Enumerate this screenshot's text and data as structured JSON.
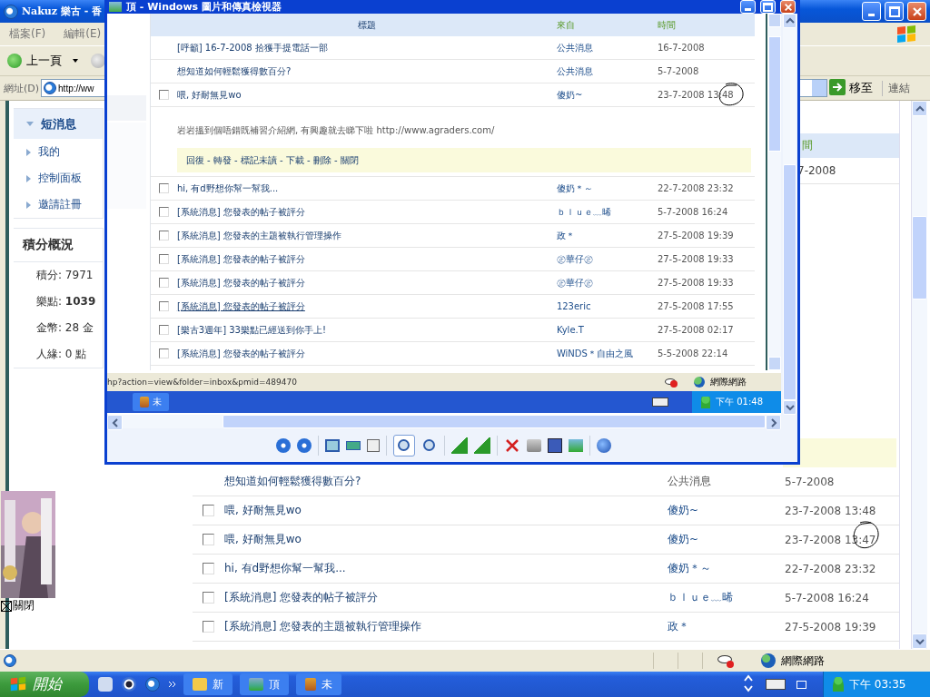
{
  "browser": {
    "title": "Nakuz 樂古 - 香",
    "menu": [
      "檔案(F)",
      "編輯(E)"
    ],
    "back_label": "上一頁",
    "address_label": "網址(D)",
    "address": "http://ww",
    "go_label": "移至",
    "links_label": "連結"
  },
  "sidebar": [
    {
      "label": "短消息",
      "selected": true
    },
    {
      "label": "我的",
      "selected": false
    },
    {
      "label": "控制面板",
      "selected": false
    },
    {
      "label": "邀請註冊",
      "selected": false
    }
  ],
  "points": {
    "title": "積分概況",
    "lines": [
      "積分: 7971",
      "樂點: **1039**",
      "金幣: 28 金",
      "人緣: 0 點"
    ]
  },
  "ad": {
    "kind": "picture",
    "close_label": "關閉"
  },
  "inbox": {
    "header_fragment": "間",
    "top_row_fragment": "7-2008",
    "rows": [
      {
        "kind": "notice",
        "subject": "想知道如何輕鬆獲得數百分?",
        "from": "公共消息",
        "time": "5-7-2008"
      },
      {
        "kind": "message",
        "subject": "喂, 好耐無見wo",
        "from": "傻奶~",
        "time": "23-7-2008 13:48",
        "checked": false
      },
      {
        "kind": "message",
        "subject": "喂, 好耐無見wo",
        "from": "傻奶~",
        "time": "23-7-2008 13:47",
        "checked": false
      },
      {
        "kind": "message",
        "subject": "hi, 有d野想你幫一幫我...",
        "from": "傻奶＊～",
        "time": "22-7-2008 23:32",
        "checked": false
      },
      {
        "kind": "message",
        "subject": "[系統消息] 您發表的帖子被評分",
        "from": "ｂｌｕｅ﹏晞",
        "time": "5-7-2008 16:24",
        "checked": false
      },
      {
        "kind": "message",
        "subject": "[系統消息] 您發表的主題被執行管理操作",
        "from": "政＊",
        "time": "27-5-2008 19:39",
        "checked": false
      }
    ]
  },
  "status_bar": {
    "zone": "網際網路"
  },
  "taskbar": {
    "start": "開始",
    "tasks": [
      "新",
      "頂",
      "未"
    ],
    "clock": "下午 03:35"
  },
  "viewer": {
    "title": "頂 - Windows 圖片和傳真檢視器",
    "image": {
      "columns": [
        "標題",
        "來自",
        "時間"
      ],
      "rows": [
        {
          "kind": "notice",
          "subject": "[呼籲] 16-7-2008 拾獲手提電話一部",
          "from": "公共消息",
          "time": "16-7-2008",
          "hovered": false
        },
        {
          "kind": "notice",
          "subject": "想知道如何輕鬆獲得數百分?",
          "from": "公共消息",
          "time": "5-7-2008",
          "hovered": false
        },
        {
          "kind": "message",
          "subject": "喂, 好耐無見wo",
          "from": "傻奶~",
          "time": "23-7-2008 13:48",
          "hovered": false,
          "checked": false
        },
        {
          "kind": "expanded",
          "body": "岩岩搵到個唔錯既補習介紹網, 有興趣就去睇下啦  http://www.agraders.com/",
          "actions": "回復 - 轉發 - 標記未讀 - 下載 - 刪除 - 關閉"
        },
        {
          "kind": "message",
          "subject": "hi, 有d野想你幫一幫我...",
          "from": "傻奶＊～",
          "time": "22-7-2008 23:32",
          "hovered": false,
          "checked": false
        },
        {
          "kind": "message",
          "subject": "[系統消息] 您發表的帖子被評分",
          "from": "ｂｌｕｅ﹏晞",
          "time": "5-7-2008 16:24",
          "hovered": false,
          "checked": false
        },
        {
          "kind": "message",
          "subject": "[系統消息] 您發表的主題被執行管理操作",
          "from": "政＊",
          "time": "27-5-2008 19:39",
          "hovered": false,
          "checked": false
        },
        {
          "kind": "message",
          "subject": "[系統消息] 您發表的帖子被評分",
          "from": "㊣華仔㊣",
          "time": "27-5-2008 19:33",
          "hovered": false,
          "checked": false
        },
        {
          "kind": "message",
          "subject": "[系統消息] 您發表的帖子被評分",
          "from": "㊣華仔㊣",
          "time": "27-5-2008 19:33",
          "hovered": false,
          "checked": false
        },
        {
          "kind": "message",
          "subject": "[系統消息] 您發表的帖子被評分",
          "from": "123eric",
          "time": "27-5-2008 17:55",
          "hovered": true,
          "checked": false
        },
        {
          "kind": "message",
          "subject": "[樂古3週年] 33樂點已經送到你手上!",
          "from": "Kyle.T",
          "time": "27-5-2008 02:17",
          "hovered": false,
          "checked": false
        },
        {
          "kind": "message",
          "subject": "[系統消息] 您發表的帖子被評分",
          "from": "WiNDS＊自由之風",
          "time": "5-5-2008 22:14",
          "hovered": false,
          "checked": false
        }
      ],
      "status_url": "hp?action=view&folder=inbox&pmid=489470",
      "zone": "網際網路",
      "task": "未",
      "clock": "下午 01:48"
    }
  }
}
